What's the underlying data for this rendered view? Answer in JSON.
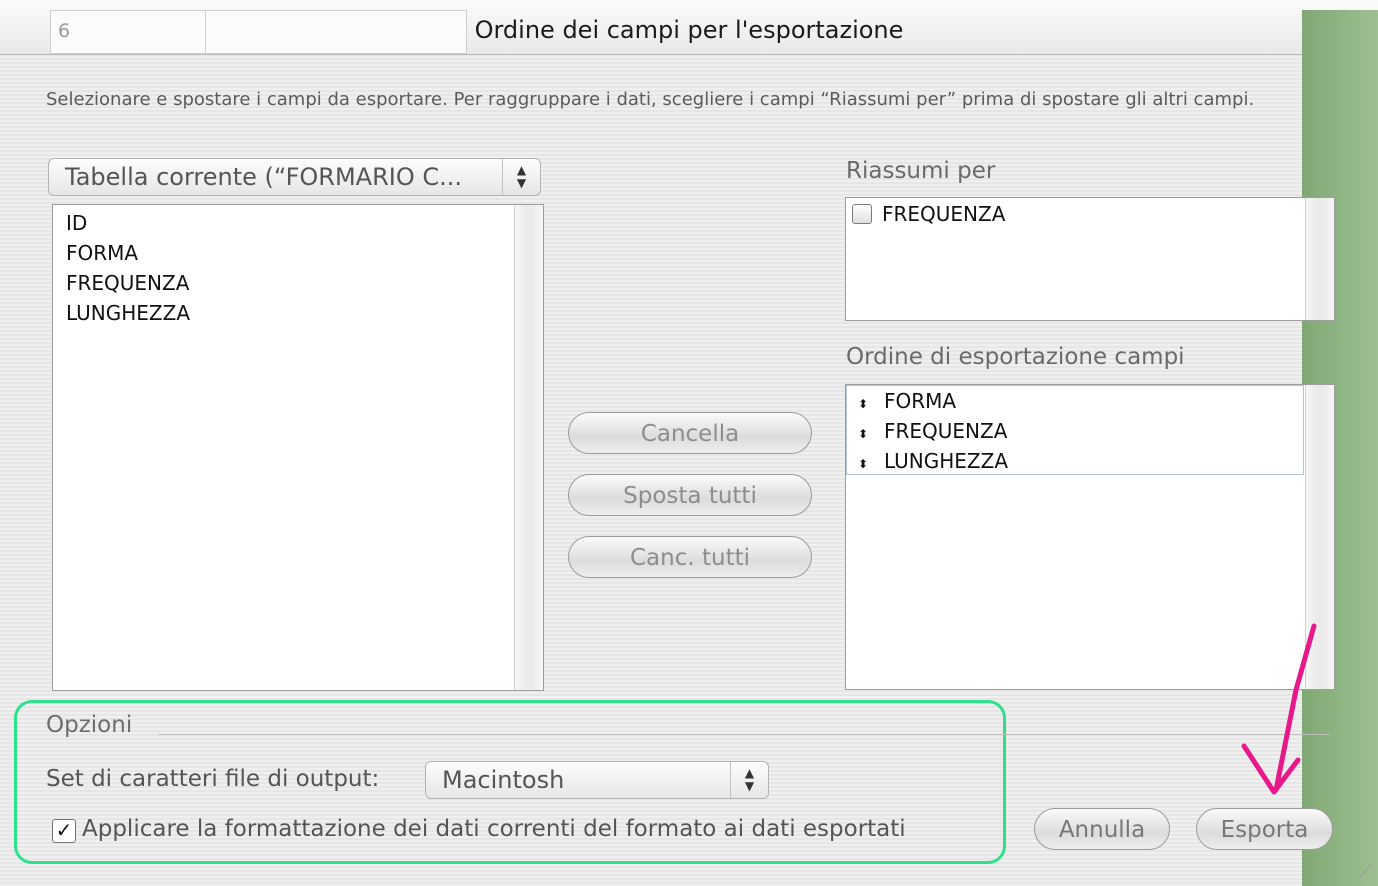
{
  "window": {
    "title": "Ordine dei campi per l'esportazione",
    "background_cell_value": "6"
  },
  "instructions": "Selezionare e spostare i campi da esportare.  Per raggruppare i dati, scegliere i campi “Riassumi per” prima di spostare gli altri campi.",
  "table_popup": {
    "label": "Tabella corrente (“FORMARIO C..."
  },
  "fields": [
    "ID",
    "FORMA",
    "FREQUENZA",
    "LUNGHEZZA"
  ],
  "summary": {
    "label": "Riassumi per",
    "items": [
      {
        "label": "FREQUENZA",
        "checked": false
      }
    ]
  },
  "export_order": {
    "label": "Ordine di esportazione campi",
    "items": [
      "FORMA",
      "FREQUENZA",
      "LUNGHEZZA"
    ],
    "handle_glyph": "⬍"
  },
  "buttons": {
    "cancel": "Cancella",
    "move_all": "Sposta tutti",
    "clear_all": "Canc. tutti",
    "annulla": "Annulla",
    "esporta": "Esporta"
  },
  "options": {
    "label": "Opzioni",
    "charset_label": "Set di caratteri file di output:",
    "charset_value": "Macintosh",
    "apply_format_label": "Applicare la formattazione dei dati correnti del formato ai dati esportati",
    "apply_format_checked": true,
    "check_glyph": "✓"
  },
  "colors": {
    "highlight_frame": "#2ee08a",
    "annotation_arrow": "#e8178a"
  }
}
